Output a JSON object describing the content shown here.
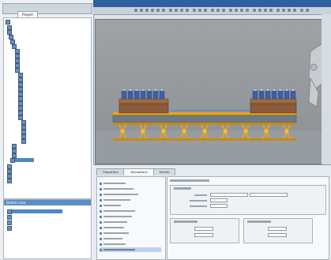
{
  "colors": {
    "accent": "#2f5f9e",
    "selection": "#4f86c6",
    "conveyor_frame": "#e8a317",
    "conveyor_belt": "#6f7a84",
    "box_brown": "#8a5a3a",
    "bottle_blue": "#3e5fa8"
  },
  "left_panel": {
    "tab_label": "Project",
    "tree_icon": "folder-icon",
    "details_label": "Details view"
  },
  "inspector": {
    "tabs": [
      "Properties",
      "Animations",
      "Events"
    ],
    "active_tab": 1
  },
  "icons": {
    "tree_node": "tree-node-icon",
    "nav_item": "property-item-icon",
    "toolbar": "toolbar-icon",
    "robot": "robot-arm-icon"
  }
}
